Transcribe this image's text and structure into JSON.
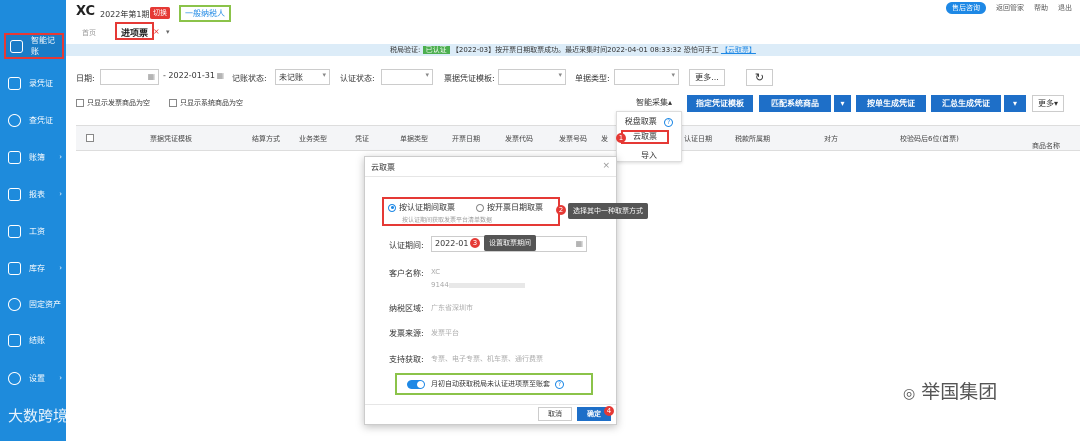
{
  "sidebar": {
    "items": [
      {
        "label": "智能记账",
        "icon": "smart-bookkeeping-icon",
        "arrow": ""
      },
      {
        "label": "录凭证",
        "icon": "voucher-entry-icon",
        "arrow": ""
      },
      {
        "label": "查凭证",
        "icon": "search-voucher-icon",
        "arrow": ""
      },
      {
        "label": "账簿",
        "icon": "ledger-icon",
        "arrow": "›"
      },
      {
        "label": "报表",
        "icon": "report-icon",
        "arrow": "›"
      },
      {
        "label": "工资",
        "icon": "salary-icon",
        "arrow": ""
      },
      {
        "label": "库存",
        "icon": "inventory-icon",
        "arrow": "›"
      },
      {
        "label": "固定资产",
        "icon": "fixed-asset-icon",
        "arrow": ""
      },
      {
        "label": "结账",
        "icon": "closing-icon",
        "arrow": ""
      },
      {
        "label": "设置",
        "icon": "settings-icon",
        "arrow": "›"
      }
    ],
    "footer_logo": "大数跨境"
  },
  "header": {
    "company": "XC",
    "period": "2022年第1期",
    "switch_label": "切换",
    "tax_type": "一般纳税人",
    "service_btn": "售后咨询",
    "links": [
      "返回管家",
      "帮助",
      "退出"
    ]
  },
  "tabs": {
    "home": "首页",
    "active": "进项票",
    "close": "×",
    "more": "▾"
  },
  "notice": {
    "prefix": "税局验证:",
    "status": "已认证",
    "message": "【2022-03】按开票日期取票成功。最近采集时间2022-04-01 08:33:32 恐怕可手工",
    "link": "【云取票】"
  },
  "filters": {
    "date_label": "日期:",
    "date_start": "",
    "date_end": "- 2022-01-31",
    "book_status_label": "记账状态:",
    "book_status_value": "未记账",
    "cert_status_label": "认证状态:",
    "cert_status_value": "",
    "template_label": "票据凭证模板:",
    "template_value": "",
    "doc_type_label": "单据类型:",
    "doc_type_value": "",
    "more": "更多...",
    "refresh": "↻"
  },
  "checks": {
    "invoice_empty": "只显示发票商品为空",
    "system_empty": "只显示系统商品为空"
  },
  "actions": {
    "smart_collect": "智能采集",
    "designate_template": "指定凭证模板",
    "match_goods": "匹配系统商品",
    "per_invoice": "按单生成凭证",
    "summary": "汇总生成凭证",
    "more": "更多"
  },
  "dropdown": {
    "items": [
      "税盘取票",
      "云取票",
      "导入"
    ],
    "help": "?"
  },
  "table": {
    "headers": [
      "票据凭证模板",
      "结算方式",
      "业务类型",
      "凭证",
      "单据类型",
      "开票日期",
      "发票代码",
      "发票号码",
      "发",
      "认证日期",
      "税款所属期",
      "对方",
      "校验码后6位(首票)",
      "商品名称"
    ]
  },
  "modal": {
    "title": "云取票",
    "close": "×",
    "radio_cert": "按认证期间取票",
    "radio_invoice": "按开票日期取票",
    "radio_hint": "按认证期间获取发票平台清单数据",
    "period_label": "认证期间:",
    "period_value": "2022-01",
    "customer_label": "客户名称:",
    "customer_name": "XC",
    "customer_code": "9144",
    "region_label": "纳税区域:",
    "region_value": "广东省深圳市",
    "source_label": "发票来源:",
    "source_value": "发票平台",
    "support_label": "支持获取:",
    "support_value": "专票、电子专票、机车票、通行费票",
    "auto_text": "月初自动获取税局未认证进项票至账套",
    "cancel": "取消",
    "confirm": "确定"
  },
  "tips": {
    "step2": "选择其中一种取票方式",
    "step3": "设置取票期间"
  },
  "badges": [
    "1",
    "2",
    "3",
    "4"
  ],
  "watermark": "举国集团",
  "colors": {
    "sidebar": "#1e8bdc",
    "primary": "#1e6fc8",
    "highlight_red": "#e53935",
    "highlight_green": "#8bc34a"
  }
}
